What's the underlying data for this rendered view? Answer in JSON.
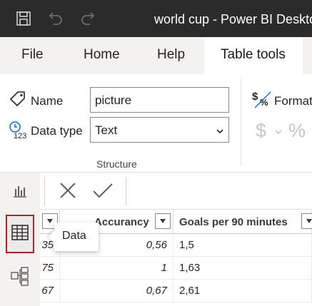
{
  "window": {
    "title": "world cup - Power BI Deskto"
  },
  "ribbon_tabs": [
    "File",
    "Home",
    "Help",
    "Table tools"
  ],
  "structure": {
    "name_label": "Name",
    "name_value": "picture",
    "datatype_label": "Data type",
    "datatype_value": "Text",
    "group_label": "Structure"
  },
  "formatting": {
    "format_label": "Formatt",
    "currency_symbol": "$",
    "percent_symbol": "%"
  },
  "table": {
    "headers": [
      "",
      "Accurancy",
      "Goals per 90 minutes"
    ],
    "rows": [
      [
        "35",
        "0,56",
        "1,5"
      ],
      [
        "75",
        "1",
        "1,63"
      ],
      [
        "67",
        "0,67",
        "2,61"
      ]
    ]
  },
  "tooltip": {
    "text": "Data"
  },
  "colors": {
    "titlebar": "#2b2b2b",
    "ribbon": "#f3f2f1",
    "active_nav_border": "#a4262c"
  }
}
